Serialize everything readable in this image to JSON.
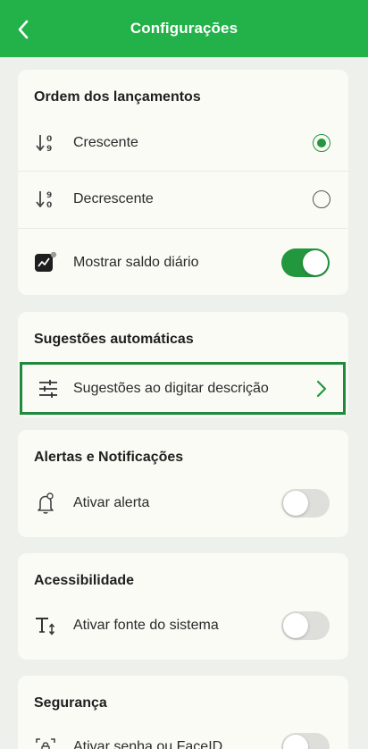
{
  "header": {
    "title": "Configurações",
    "back_icon": "chevron-left-icon"
  },
  "colors": {
    "primary_green": "#23b14a",
    "accent_green": "#23973d",
    "background": "#eef0ec",
    "card": "#fbfbf6"
  },
  "order_section": {
    "title": "Ordem dos lançamentos",
    "ascending": {
      "label": "Crescente",
      "selected": true,
      "icon_digits_top": "0",
      "icon_digits_bottom": "9"
    },
    "descending": {
      "label": "Decrescente",
      "selected": false,
      "icon_digits_top": "9",
      "icon_digits_bottom": "0"
    },
    "daily_balance": {
      "label": "Mostrar saldo diário",
      "enabled": true
    }
  },
  "suggestions_section": {
    "title": "Sugestões automáticas",
    "item": {
      "label": "Sugestões ao digitar descrição"
    }
  },
  "alerts_section": {
    "title": "Alertas e Notificações",
    "item": {
      "label": "Ativar alerta",
      "enabled": false
    }
  },
  "accessibility_section": {
    "title": "Acessibilidade",
    "item": {
      "label": "Ativar fonte do sistema",
      "enabled": false
    }
  },
  "security_section": {
    "title": "Segurança",
    "item": {
      "label": "Ativar senha ou FaceID",
      "enabled": false
    }
  }
}
